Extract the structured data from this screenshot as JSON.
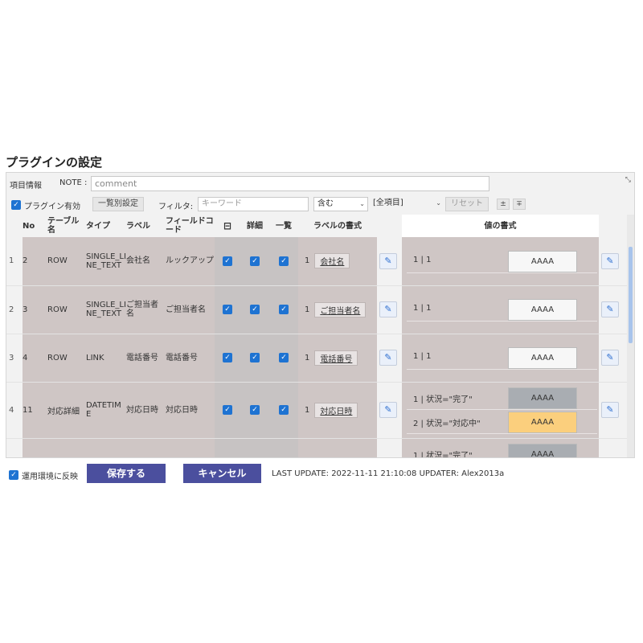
{
  "page_title": "プラグインの設定",
  "item_info": {
    "label": "項目情報",
    "note_label": "NOTE :",
    "note_value": "comment",
    "corner_icon": "collapse-icon"
  },
  "toolbar": {
    "plugin_enabled_label": "プラグイン有効",
    "bulk_setting_button": "一覧別設定",
    "filter_label": "フィルタ:",
    "filter_placeholder": "キーワード",
    "match_select": "含む",
    "field_select": "[全項目]",
    "reset_button": "リセット",
    "expand_icon": "±",
    "collapse_icon": "∓"
  },
  "columns": {
    "no": "No",
    "table_name": "テーブル名",
    "type": "タイプ",
    "label": "ラベル",
    "field_code": "フィールドコード",
    "toggle_icon": "⊟",
    "detail": "詳細",
    "list": "一覧",
    "label_format": "ラベルの書式",
    "value_format": "値の書式"
  },
  "rows": [
    {
      "index": "1",
      "no": "2",
      "table_name": "ROW",
      "type": "SINGLE_LINE_TEXT",
      "label": "会社名",
      "field_code": "ルックアップ",
      "label_format_num": "1",
      "label_format_text": "会社名",
      "values": [
        {
          "cond": "1 | 1",
          "sample": "AAAA",
          "style": "plain"
        }
      ]
    },
    {
      "index": "2",
      "no": "3",
      "table_name": "ROW",
      "type": "SINGLE_LINE_TEXT",
      "label": "ご担当者名",
      "field_code": "ご担当者名",
      "label_format_num": "1",
      "label_format_text": "ご担当者名",
      "values": [
        {
          "cond": "1 | 1",
          "sample": "AAAA",
          "style": "plain"
        }
      ]
    },
    {
      "index": "3",
      "no": "4",
      "table_name": "ROW",
      "type": "LINK",
      "label": "電話番号",
      "field_code": "電話番号",
      "label_format_num": "1",
      "label_format_text": "電話番号",
      "values": [
        {
          "cond": "1 | 1",
          "sample": "AAAA",
          "style": "plain"
        }
      ]
    },
    {
      "index": "4",
      "no": "11",
      "table_name": "対応詳細",
      "type": "DATETIME",
      "label": "対応日時",
      "field_code": "対応日時",
      "label_format_num": "1",
      "label_format_text": "対応日時",
      "values": [
        {
          "cond": "1 | 状況=\"完了\"",
          "sample": "AAAA",
          "style": "gray"
        },
        {
          "cond": "2 | 状況=\"対応中\"",
          "sample": "AAAA",
          "style": "orange"
        }
      ]
    },
    {
      "index": "",
      "no": "",
      "table_name": "",
      "type": "",
      "label": "",
      "field_code": "",
      "label_format_num": "",
      "label_format_text": "",
      "values": [
        {
          "cond": "1 | 状況=\"完了\"",
          "sample": "AAAA",
          "style": "gray"
        }
      ]
    }
  ],
  "footer": {
    "apply_env_label": "運用環境に反映",
    "save_button": "保存する",
    "cancel_button": "キャンセル",
    "last_update": "LAST UPDATE: 2022-11-11 21:10:08 UPDATER: Alex2013a"
  },
  "colors": {
    "accent": "#1e73d2",
    "row_bg": "#cfc6c5",
    "button_bg": "#4b4f9e",
    "orange_value": "#fbcf7d",
    "gray_value": "#a9adb2"
  }
}
